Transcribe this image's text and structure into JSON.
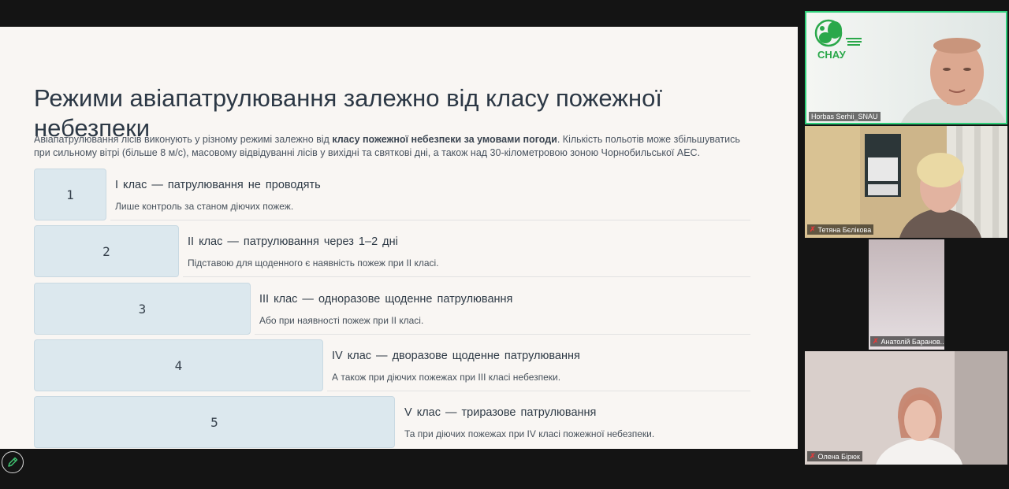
{
  "slide": {
    "title": "Режими авіапатрулювання залежно від класу пожежної небезпеки",
    "intro_before": "Авіапатрулювання лісів виконують у різному режимі залежно від ",
    "intro_bold": "класу пожежної небезпеки за умовами погоди",
    "intro_after": ". Кількість польотів може збільшуватись при сильному вітрі (більше 8 м/с), масовому відвідуванні лісів у вихідні та святкові дні, а також над 30-кілометровою зоною Чорнобильської АЕС.",
    "rows": [
      {
        "num": "1",
        "title": "І клас — патрулювання не проводять",
        "sub": "Лише контроль за станом діючих пожеж."
      },
      {
        "num": "2",
        "title": "ІІ клас — патрулювання через 1–2 дні",
        "sub": "Підставою для щоденного є наявність пожеж при ІІ класі."
      },
      {
        "num": "3",
        "title": "ІІІ клас — одноразове щоденне патрулювання",
        "sub": "Або при наявності пожеж при ІІ класі."
      },
      {
        "num": "4",
        "title": "IV клас — дворазове щоденне патрулювання",
        "sub": "А також при діючих пожежах при ІІІ класі небезпеки."
      },
      {
        "num": "5",
        "title": "V клас — триразове патрулювання",
        "sub": "Та при діючих пожежах при IV класі пожежної небезпеки."
      }
    ]
  },
  "participants": [
    {
      "name": "Horbas Serhii_SNAU",
      "logo_text": "СНАУ",
      "muted": false
    },
    {
      "name": "Тетяна Бєлікова",
      "muted": true
    },
    {
      "name": "Анатолій Баранов...",
      "muted": true
    },
    {
      "name": "Олена Бірюк",
      "muted": true
    }
  ],
  "toolbar": {
    "annotate_icon": "pencil-icon"
  },
  "colors": {
    "slide_bg": "#f9f6f3",
    "box_bg": "#dce8ee",
    "active_speaker_border": "#2fd07a",
    "logo_green": "#2aa84a"
  }
}
